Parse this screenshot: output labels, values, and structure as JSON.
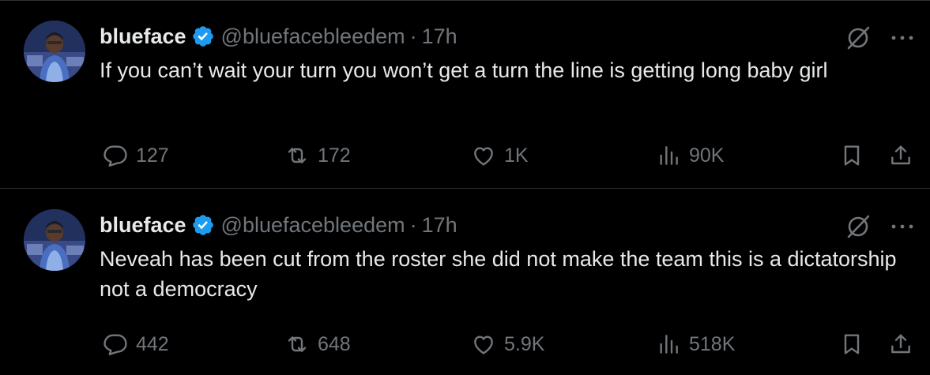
{
  "tweets": [
    {
      "author": {
        "name": "blueface",
        "handle": "@bluefacebleedem",
        "verified": true,
        "avatar_icon": "profile-photo"
      },
      "separator": "·",
      "time": "17h",
      "text": "If you can’t wait your turn you won’t get a turn the line is getting long baby girl",
      "stats": {
        "replies": "127",
        "reposts": "172",
        "likes": "1K",
        "views": "90K"
      }
    },
    {
      "author": {
        "name": "blueface",
        "handle": "@bluefacebleedem",
        "verified": true,
        "avatar_icon": "profile-photo"
      },
      "separator": "·",
      "time": "17h",
      "text": "Neveah has been cut from the roster she did not make the team this is a dictatorship not a democracy",
      "stats": {
        "replies": "442",
        "reposts": "648",
        "likes": "5.9K",
        "views": "518K"
      }
    }
  ],
  "colors": {
    "background": "#000000",
    "primary_text": "#e7e9ea",
    "secondary_text": "#71767b",
    "divider": "#2f3336",
    "verified_badge": "#1d9bf0"
  },
  "icons": [
    "grok-icon",
    "more-icon",
    "reply-icon",
    "repost-icon",
    "like-icon",
    "views-icon",
    "bookmark-icon",
    "share-icon",
    "verified-badge-icon"
  ]
}
